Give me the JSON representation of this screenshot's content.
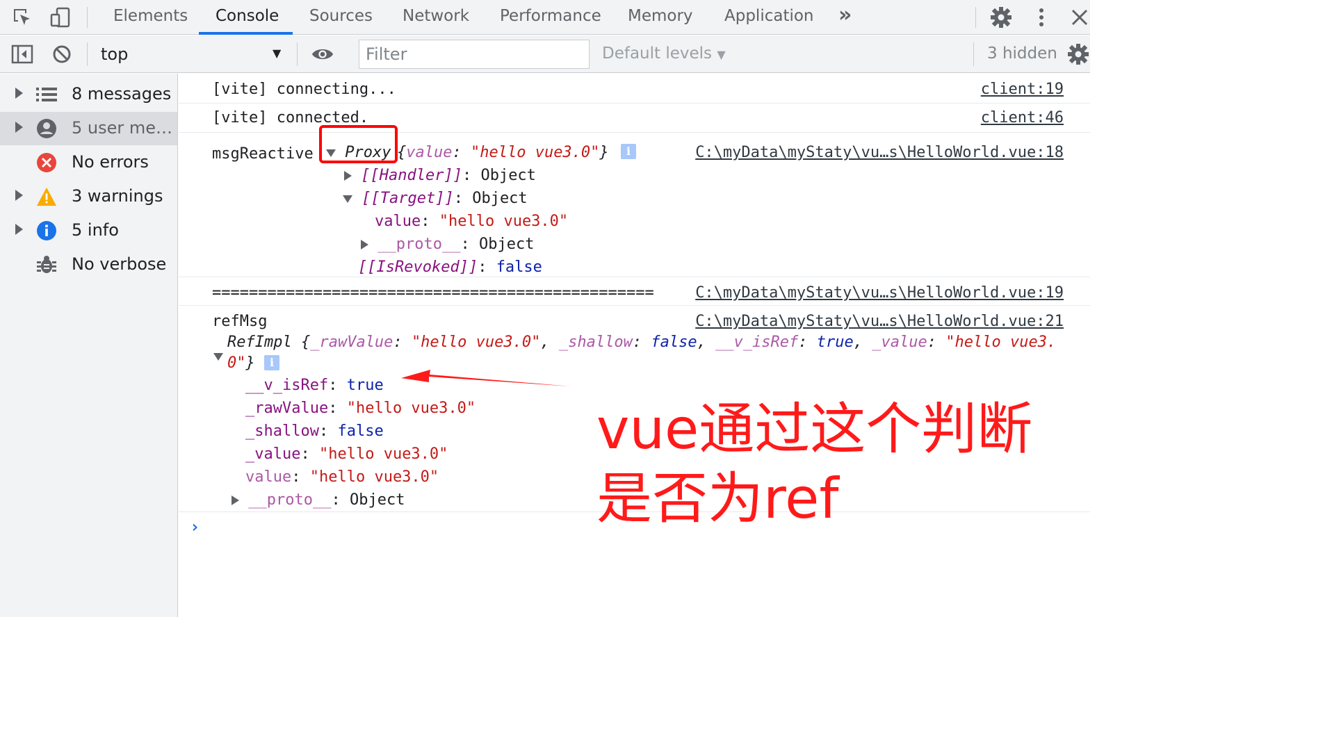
{
  "tabs": [
    "Elements",
    "Console",
    "Sources",
    "Network",
    "Performance",
    "Memory",
    "Application"
  ],
  "more_tabs": "»",
  "toolbar": {
    "context": "top",
    "filter_placeholder": "Filter",
    "levels": "Default levels",
    "hidden": "3 hidden"
  },
  "sidebar": {
    "items": [
      {
        "label": "8 messages",
        "icon": "list-icon"
      },
      {
        "label": "5 user messages",
        "icon": "user-icon"
      },
      {
        "label": "No errors",
        "icon": "error-icon"
      },
      {
        "label": "3 warnings",
        "icon": "warning-icon"
      },
      {
        "label": "5 info",
        "icon": "info-icon"
      },
      {
        "label": "No verbose",
        "icon": "bug-icon"
      }
    ]
  },
  "console": {
    "messages": [
      {
        "text": "[vite] connecting...",
        "source": "client:19"
      },
      {
        "text": "[vite] connected.",
        "source": "client:46"
      },
      {
        "label": "msgReactive",
        "source": "C:\\myData\\myStaty\\vu…s\\HelloWorld.vue:18",
        "proxy_label": "Proxy",
        "preview": "{value: \"hello vue3.0\"}",
        "preview_key": "value",
        "preview_value": "\"hello vue3.0\"",
        "handler_key": "[[Handler]]",
        "handler_value": "Object",
        "target_key": "[[Target]]",
        "target_value": "Object",
        "value_key": "value",
        "value_value": "\"hello vue3.0\"",
        "proto_key": "__proto__",
        "proto_value": "Object",
        "revoked_key": "[[IsRevoked]]",
        "revoked_value": "false"
      },
      {
        "text": "================================================",
        "source": "C:\\myData\\myStaty\\vu…s\\HelloWorld.vue:19"
      },
      {
        "label": "refMsg",
        "source": "C:\\myData\\myStaty\\vu…s\\HelloWorld.vue:21",
        "class_name": "RefImpl",
        "preview_line1_parts": [
          "_rawValue",
          "\"hello vue3.0\"",
          "_shallow",
          "false",
          "__v_isRef",
          "true",
          "_value",
          "\"hello vue3."
        ],
        "preview_line2": "0\"",
        "props": [
          {
            "key": "__v_isRef",
            "value": "true",
            "type": "kw"
          },
          {
            "key": "_rawValue",
            "value": "\"hello vue3.0\"",
            "type": "str"
          },
          {
            "key": "_shallow",
            "value": "false",
            "type": "kw"
          },
          {
            "key": "_value",
            "value": "\"hello vue3.0\"",
            "type": "str"
          },
          {
            "key": "value",
            "value": "\"hello vue3.0\"",
            "type": "str"
          }
        ],
        "proto_key": "__proto__",
        "proto_value": "Object"
      }
    ],
    "prompt": "›"
  },
  "annotation": {
    "line1": "vue通过这个判断",
    "line2": "是否为ref"
  },
  "colors": {
    "accent": "#1a73e8",
    "annotation": "#ff1a1a",
    "string": "#c41a16",
    "keyword": "#0d22aa",
    "key": "#881280"
  }
}
